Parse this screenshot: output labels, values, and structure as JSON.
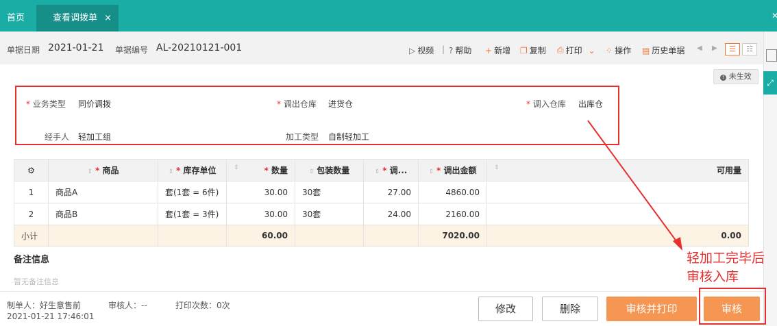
{
  "tabs": {
    "home": "首页",
    "active": "查看调拨单",
    "close_glyph": "×"
  },
  "header": {
    "date_label": "单据日期",
    "date_value": "2021-01-21",
    "number_label": "单据编号",
    "number_value": "AL-20210121-001",
    "toolbar": {
      "video": "视频",
      "help": "帮助",
      "new": "新增",
      "copy": "复制",
      "print": "打印",
      "operate": "操作",
      "history": "历史单据"
    }
  },
  "status_badge": "未生效",
  "form": {
    "business_type_label": "业务类型",
    "business_type_value": "同价调拨",
    "out_warehouse_label": "调出仓库",
    "out_warehouse_value": "进货仓",
    "in_warehouse_label": "调入仓库",
    "in_warehouse_value": "出库仓",
    "handler_label": "经手人",
    "handler_value": "轻加工组",
    "process_type_label": "加工类型",
    "process_type_value": "自制轻加工"
  },
  "table": {
    "headers": [
      "商品",
      "库存单位",
      "数量",
      "包装数量",
      "调...",
      "调出金额",
      "可用量"
    ],
    "rows": [
      {
        "idx": "1",
        "product": "商品A",
        "unit": "套(1套 = 6件)",
        "qty": "30.00",
        "pack": "30套",
        "price": "27.00",
        "amount": "4860.00",
        "avail": ""
      },
      {
        "idx": "2",
        "product": "商品B",
        "unit": "套(1套 = 3件)",
        "qty": "30.00",
        "pack": "30套",
        "price": "24.00",
        "amount": "2160.00",
        "avail": ""
      }
    ],
    "subtotal": {
      "label": "小计",
      "qty": "60.00",
      "amount": "7020.00",
      "avail": "0.00"
    }
  },
  "remarks": {
    "title": "备注信息",
    "empty": "暂无备注信息"
  },
  "footer": {
    "creator": "制单人：好生意售前",
    "created_at": "2021-01-21 17:46:01",
    "auditor": "审核人：--",
    "print_count": "打印次数：0次",
    "buttons": {
      "edit": "修改",
      "delete": "删除",
      "audit_print": "审核并打印",
      "audit": "审核"
    }
  },
  "annotation": {
    "line1": "轻加工完毕后",
    "line2": "审核入库"
  },
  "colors": {
    "brand": "#1aada6",
    "accent": "#f59652",
    "annotation": "#e53030"
  }
}
